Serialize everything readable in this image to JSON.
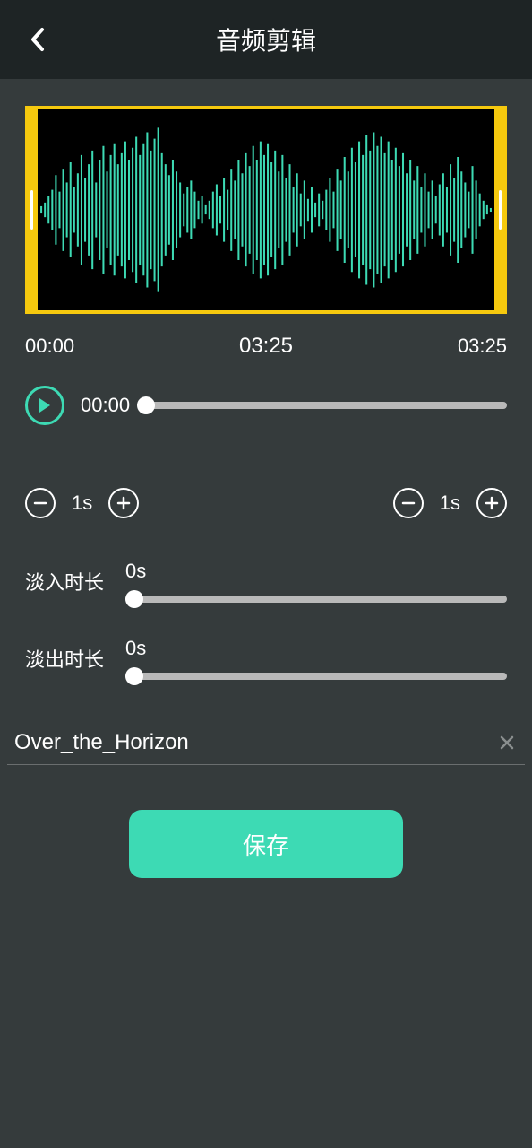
{
  "header": {
    "title": "音频剪辑"
  },
  "time": {
    "start": "00:00",
    "current": "03:25",
    "end": "03:25"
  },
  "playback": {
    "position": "00:00"
  },
  "trim": {
    "left_step": "1s",
    "right_step": "1s"
  },
  "fade_in": {
    "label": "淡入时长",
    "value": "0s"
  },
  "fade_out": {
    "label": "淡出时长",
    "value": "0s"
  },
  "filename": "Over_the_Horizon",
  "save_label": "保存"
}
